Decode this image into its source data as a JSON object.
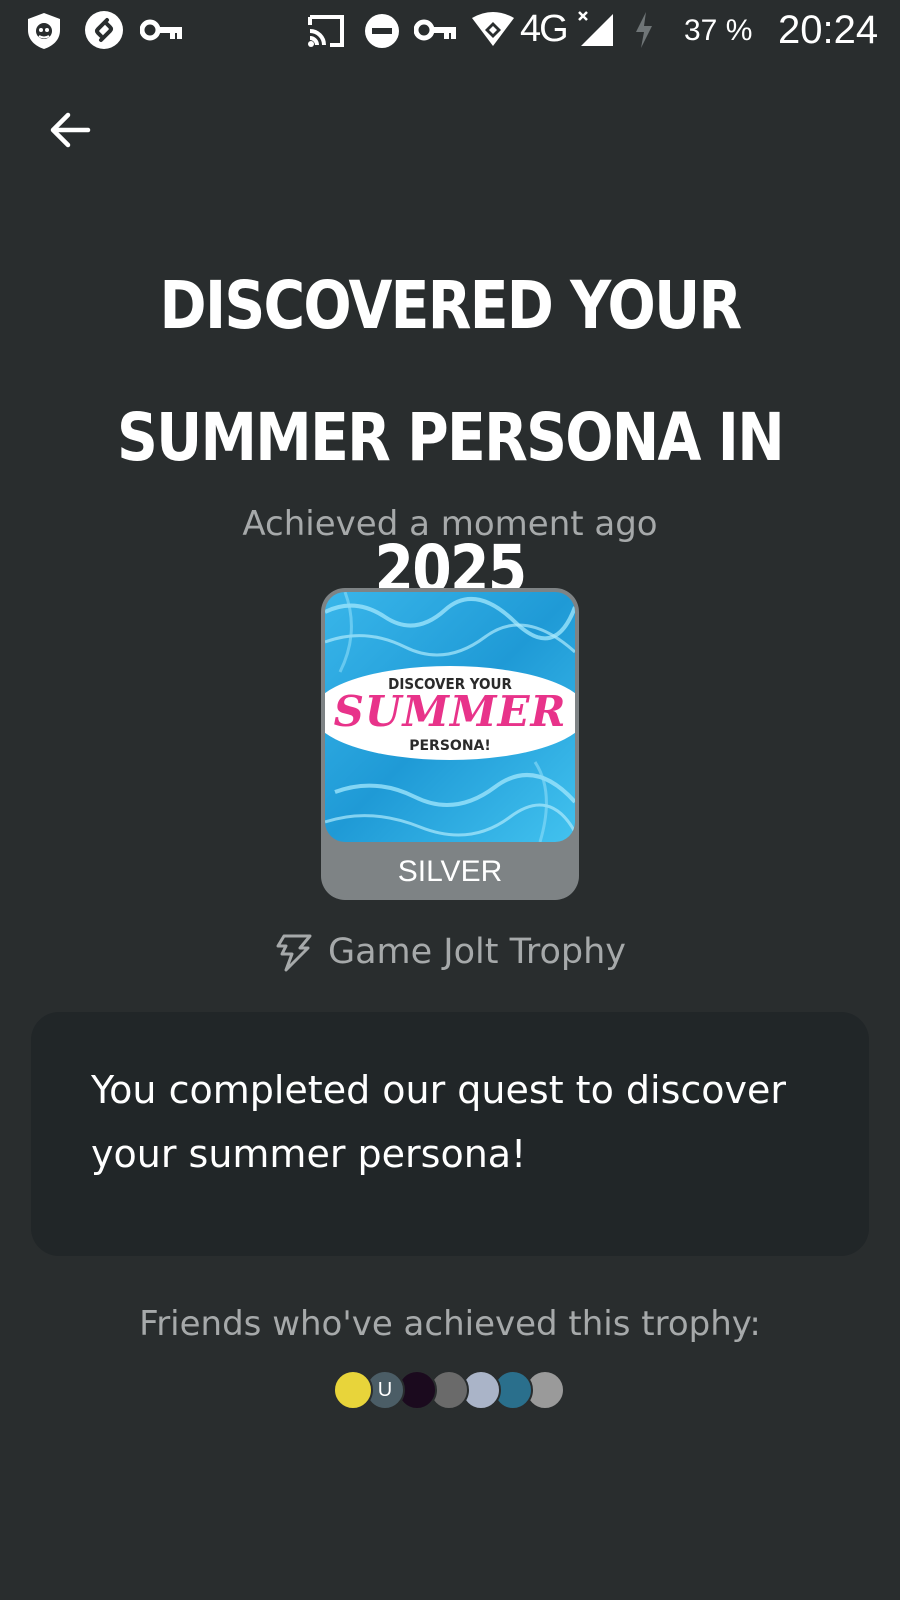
{
  "status_bar": {
    "battery": "37 %",
    "time": "20:24",
    "network": "4G",
    "left_icons": [
      "shield-icon",
      "shazam-icon",
      "key-icon"
    ],
    "right_icons": [
      "cast-icon",
      "do-not-disturb-icon",
      "vpn-key-icon",
      "wifi-icon",
      "signal-icon",
      "charging-icon"
    ]
  },
  "header": {
    "back_icon": "arrow-left-icon"
  },
  "trophy": {
    "title_line1": "DISCOVERED YOUR",
    "title_line2": "SUMMER PERSONA IN 2025",
    "achieved": "Achieved a moment ago",
    "image_text_top": "DISCOVER YOUR",
    "image_text_main": "SUMMER",
    "image_text_bottom": "PERSONA!",
    "level": "SILVER",
    "source_icon": "game-jolt-icon",
    "source_label": "Game Jolt Trophy",
    "description": "You completed our quest to discover your summer persona!"
  },
  "friends": {
    "label": "Friends who've achieved this trophy:",
    "avatars": [
      {
        "name": "friend-1",
        "initial": "",
        "color": "#e8d43a"
      },
      {
        "name": "friend-2",
        "initial": "U",
        "color": "#4b5d66"
      },
      {
        "name": "friend-3",
        "initial": "",
        "color": "#1b0a1e"
      },
      {
        "name": "friend-4",
        "initial": "",
        "color": "#6a6a6a"
      },
      {
        "name": "friend-5",
        "initial": "",
        "color": "#aab4c8"
      },
      {
        "name": "friend-6",
        "initial": "",
        "color": "#2a6f8c"
      },
      {
        "name": "friend-7",
        "initial": "",
        "color": "#9a9a9a"
      }
    ]
  },
  "colors": {
    "background": "#292d2e",
    "card": "#212628",
    "muted_text": "#a6a9aa",
    "trophy_silver": "#7e8385",
    "summer_pink": "#e8338a",
    "pool_blue": "#2aa6de"
  }
}
